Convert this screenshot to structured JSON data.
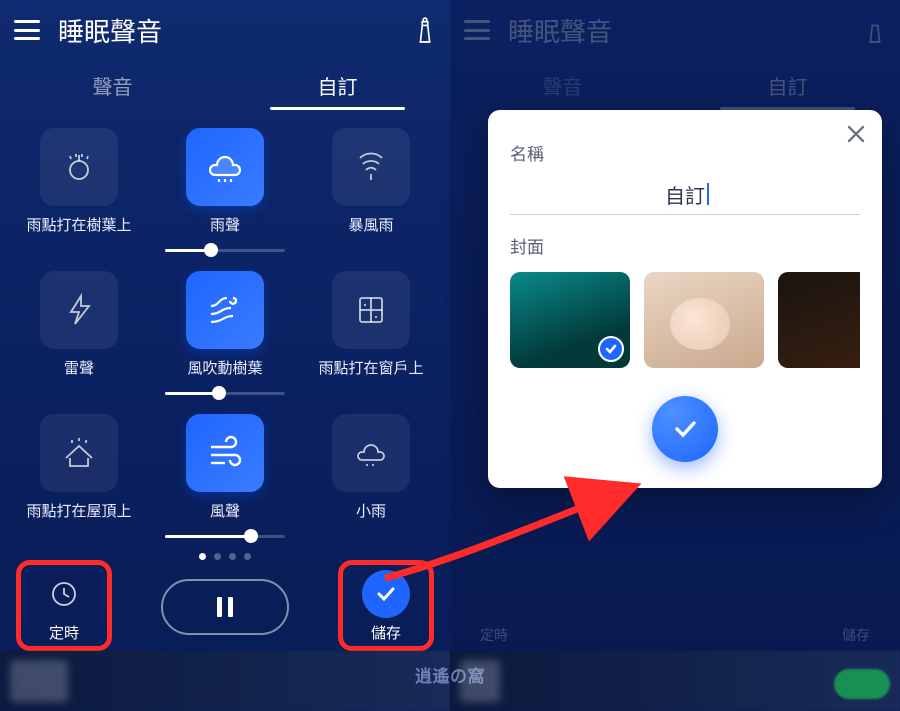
{
  "header": {
    "title": "睡眠聲音"
  },
  "tabs": {
    "sound": "聲音",
    "custom": "自訂",
    "active": "custom"
  },
  "sounds": [
    {
      "label": "雨點打在樹葉上",
      "icon": "rain-leaf",
      "active": false,
      "slider": null
    },
    {
      "label": "雨聲",
      "icon": "rain-cloud",
      "active": true,
      "slider": 0.38
    },
    {
      "label": "暴風雨",
      "icon": "tornado",
      "active": false,
      "slider": null
    },
    {
      "label": "雷聲",
      "icon": "thunder",
      "active": false,
      "slider": null
    },
    {
      "label": "風吹動樹葉",
      "icon": "wind-leaf",
      "active": true,
      "slider": 0.45
    },
    {
      "label": "雨點打在窗戶上",
      "icon": "window-rain",
      "active": false,
      "slider": null
    },
    {
      "label": "雨點打在屋頂上",
      "icon": "roof-rain",
      "active": false,
      "slider": null
    },
    {
      "label": "風聲",
      "icon": "wind",
      "active": true,
      "slider": 0.72
    },
    {
      "label": "小雨",
      "icon": "drizzle",
      "active": false,
      "slider": null
    }
  ],
  "pager": {
    "count": 4,
    "active": 0
  },
  "controls": {
    "timer": "定時",
    "save": "儲存",
    "playing": true
  },
  "dialog": {
    "name_label": "名稱",
    "name_value": "自訂",
    "cover_label": "封面",
    "selected_cover": 0
  },
  "watermark": {
    "badge": "逍遙の窩"
  }
}
